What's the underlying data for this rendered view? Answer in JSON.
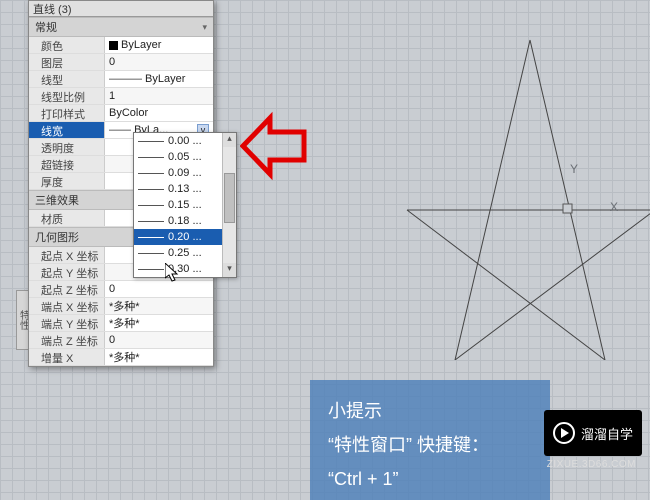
{
  "panel": {
    "title": "直线 (3)",
    "sections": {
      "general": {
        "header": "常规",
        "rows": [
          {
            "label": "颜色",
            "value": "ByLayer",
            "swatch": true
          },
          {
            "label": "图层",
            "value": "0"
          },
          {
            "label": "线型",
            "value": "ByLayer",
            "dash": true
          },
          {
            "label": "线型比例",
            "value": "1"
          },
          {
            "label": "打印样式",
            "value": "ByColor"
          },
          {
            "label": "线宽",
            "value": "ByLa...",
            "dash": true,
            "selected": true
          },
          {
            "label": "透明度"
          },
          {
            "label": "超链接"
          },
          {
            "label": "厚度"
          }
        ]
      },
      "threed": {
        "header": "三维效果",
        "rows": [
          {
            "label": "材质"
          }
        ]
      },
      "geom": {
        "header": "几何图形",
        "rows": [
          {
            "label": "起点 X 坐标"
          },
          {
            "label": "起点 Y 坐标"
          },
          {
            "label": "起点 Z 坐标",
            "value": "0"
          },
          {
            "label": "端点 X 坐标",
            "value": "*多种*"
          },
          {
            "label": "端点 Y 坐标",
            "value": "*多种*"
          },
          {
            "label": "端点 Z 坐标",
            "value": "0"
          },
          {
            "label": "增量 X",
            "value": "*多种*"
          }
        ]
      }
    },
    "dropdown": {
      "items": [
        "0.00 ...",
        "0.05 ...",
        "0.09 ...",
        "0.13 ...",
        "0.15 ...",
        "0.18 ...",
        "0.20 ...",
        "0.25 ...",
        "0.30 ..."
      ],
      "selected_index": 6
    }
  },
  "canvas": {
    "axis_y": "Y",
    "axis_x": "X"
  },
  "tip": {
    "title": "小提示",
    "line2": "“特性窗口” 快捷键：",
    "line3": "“Ctrl + 1”"
  },
  "watermark": {
    "text": "溜溜自学",
    "sub": "ZIXUE.3D66.COM"
  },
  "side_tab": "特性"
}
